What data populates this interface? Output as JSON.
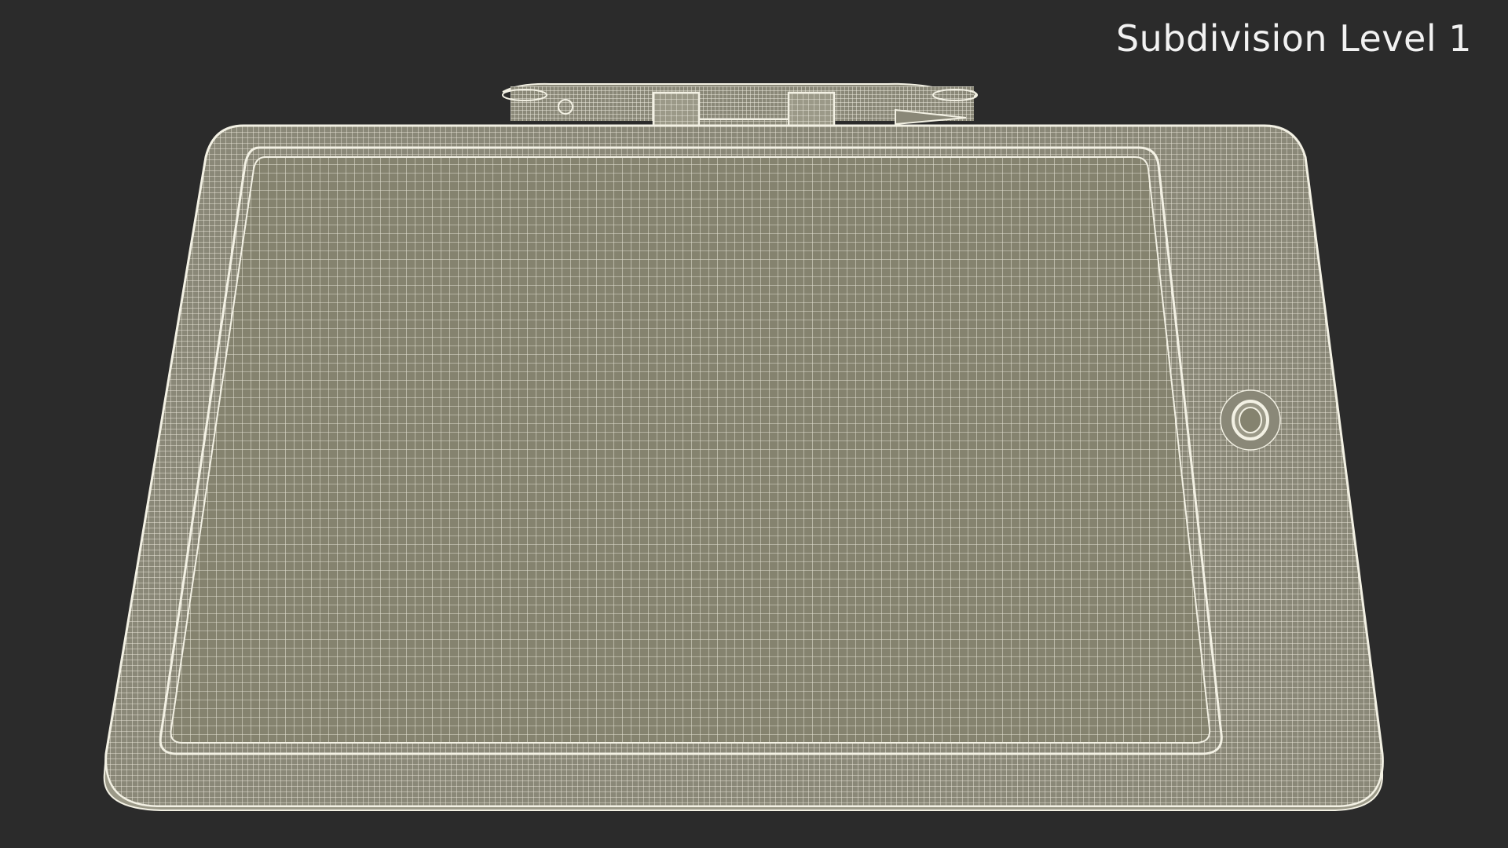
{
  "overlay": {
    "subdivision_label": "Subdivision Level 1"
  },
  "colors": {
    "background": "#2b2b2b",
    "mesh_fill": "#8a8878",
    "wire": "#f3f1e4",
    "screen_fill": "#85836f"
  },
  "objects": {
    "tablet": "tablet-wireframe-model",
    "stylus": "stylus-pencil-wireframe",
    "camera": "rear-camera-lens"
  }
}
